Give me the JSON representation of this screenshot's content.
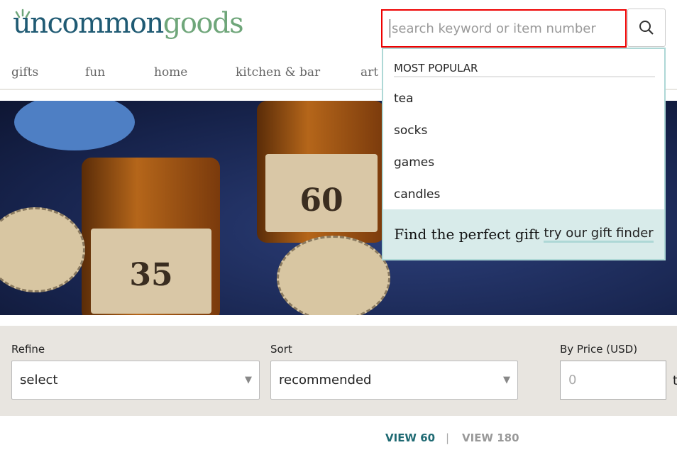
{
  "brand": {
    "logo_part1": "uncommon",
    "logo_part2": "goods"
  },
  "nav": [
    "gifts",
    "fun",
    "home",
    "kitchen & bar",
    "art"
  ],
  "search": {
    "placeholder": "search keyword or item number",
    "value": "",
    "button_icon": "search-icon"
  },
  "dropdown": {
    "heading": "MOST POPULAR",
    "items": [
      "tea",
      "socks",
      "games",
      "candles"
    ],
    "finder_text": "Find the perfect gift",
    "finder_link": "try our gift finder"
  },
  "hero": {
    "labels": [
      "60",
      "35"
    ]
  },
  "filters": {
    "refine_label": "Refine",
    "refine_value": "select",
    "sort_label": "Sort",
    "sort_value": "recommended",
    "price_label": "By Price (USD)",
    "price_min_placeholder": "0",
    "price_to": "to"
  },
  "view": {
    "view60": "VIEW 60",
    "separator": "|",
    "view180": "VIEW 180"
  },
  "colors": {
    "brand_blue": "#1f5a73",
    "brand_green": "#6fa67a",
    "highlight": "#e00000",
    "dropdown_border": "#aed8d6",
    "view_active": "#1f6a73"
  }
}
